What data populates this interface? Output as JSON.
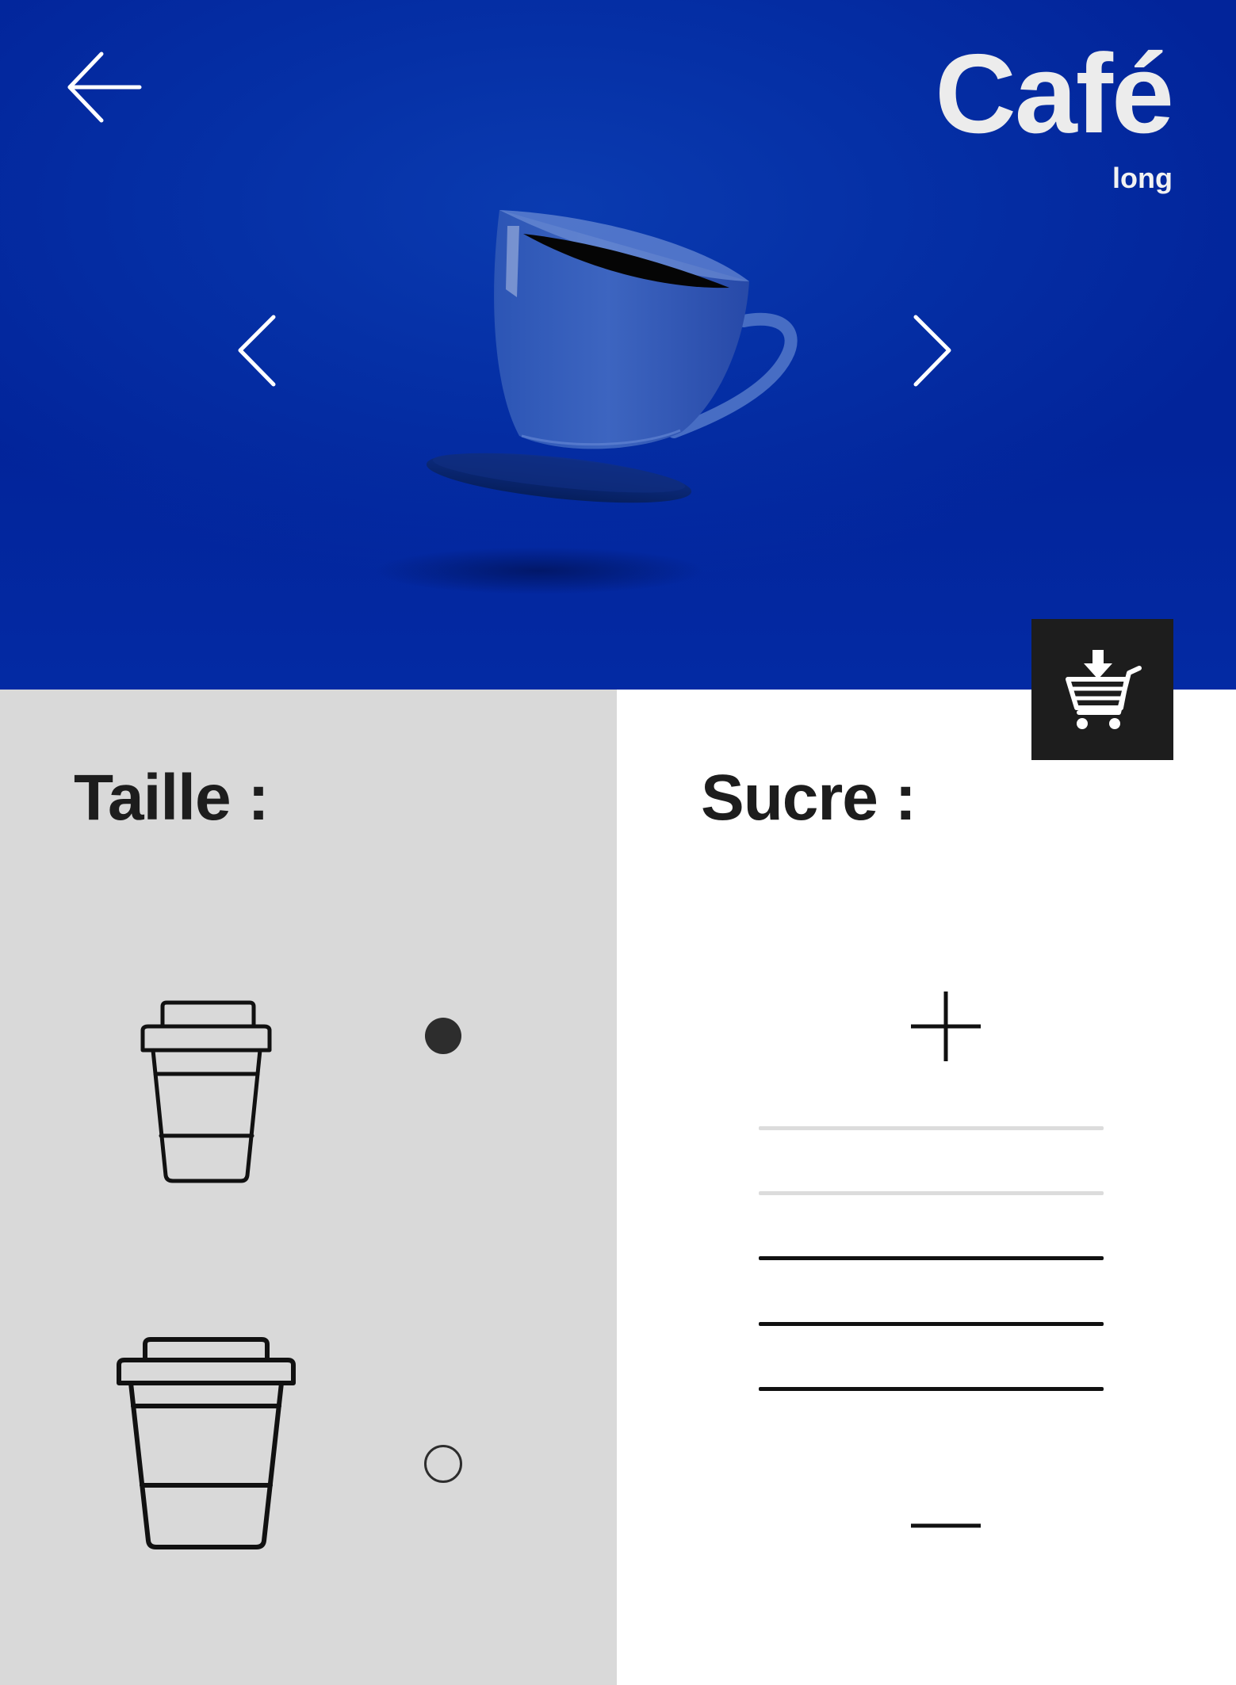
{
  "header": {
    "title": "Café",
    "subtitle": "long",
    "back_icon": "arrow-left-icon",
    "prev_icon": "chevron-left-icon",
    "next_icon": "chevron-right-icon",
    "cart_icon": "add-to-cart-icon",
    "product_image": "coffee-cup-with-saucer"
  },
  "taille": {
    "label": "Taille :",
    "options": [
      {
        "icon": "small-cup-icon",
        "selected": true
      },
      {
        "icon": "large-cup-icon",
        "selected": false
      }
    ]
  },
  "sucre": {
    "label": "Sucre :",
    "increase_icon": "plus-icon",
    "decrease_icon": "minus-icon",
    "level": 3,
    "max_level": 5
  },
  "colors": {
    "hero_blue": "#0530a6",
    "panel_grey": "#d9d9d9",
    "dark": "#1d1d1d",
    "level_off": "#dcdcdc"
  }
}
